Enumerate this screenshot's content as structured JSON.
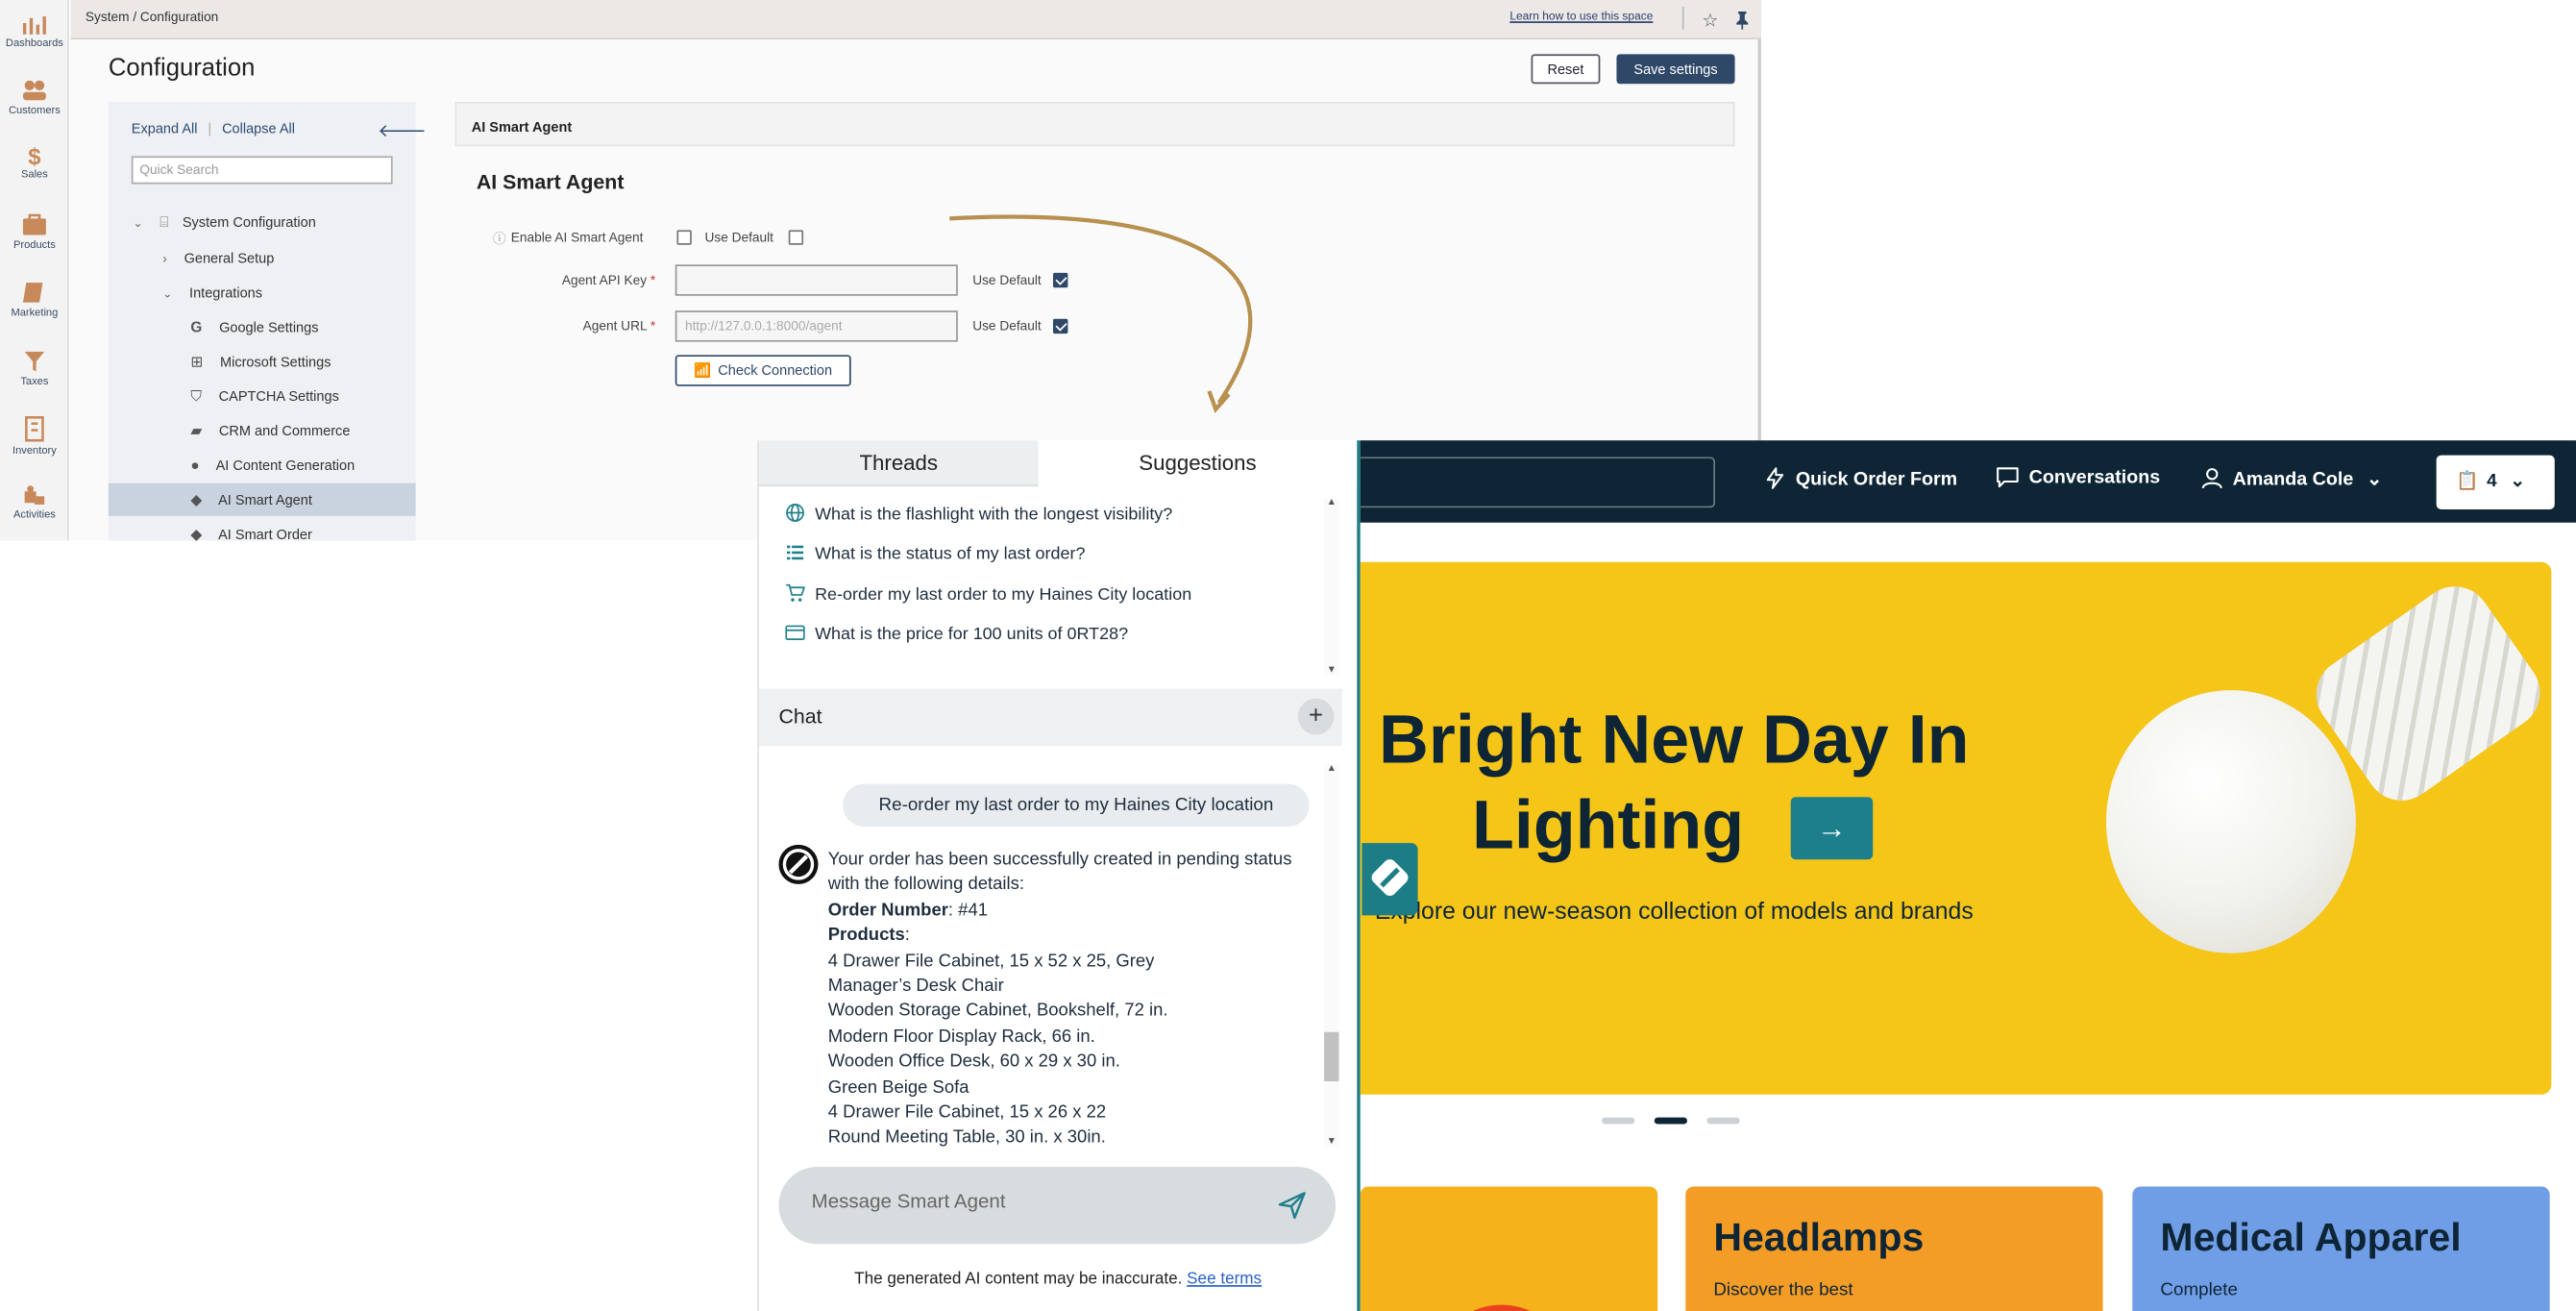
{
  "rail": {
    "items": [
      {
        "label": "Dashboards",
        "icon": "bar-chart-icon"
      },
      {
        "label": "Customers",
        "icon": "users-icon"
      },
      {
        "label": "Sales",
        "icon": "dollar-icon"
      },
      {
        "label": "Products",
        "icon": "box-icon"
      },
      {
        "label": "Marketing",
        "icon": "book-icon"
      },
      {
        "label": "Taxes",
        "icon": "funnel-icon"
      },
      {
        "label": "Inventory",
        "icon": "building-icon"
      },
      {
        "label": "Activities",
        "icon": "puzzle-icon"
      }
    ]
  },
  "admin": {
    "breadcrumb": "System / Configuration",
    "learn_link": "Learn how to use this space",
    "page_title": "Configuration",
    "reset_label": "Reset",
    "save_label": "Save settings",
    "tree": {
      "expand_all": "Expand All",
      "collapse_all": "Collapse All",
      "search_placeholder": "Quick Search",
      "nodes": [
        "System Configuration",
        "General Setup",
        "Integrations",
        "Google Settings",
        "Microsoft Settings",
        "CAPTCHA Settings",
        "CRM and Commerce",
        "AI Content Generation",
        "AI Smart Agent",
        "AI Smart Order"
      ]
    },
    "panel_breadcrumb": "AI Smart Agent",
    "section_title": "AI Smart Agent",
    "fields": {
      "enable_label": "Enable AI Smart Agent",
      "api_key_label": "Agent API Key",
      "url_label": "Agent URL",
      "url_placeholder": "http://127.0.0.1:8000/agent",
      "use_default": "Use Default",
      "enable_checked": false,
      "enable_use_default_checked": false,
      "api_use_default_checked": true,
      "url_use_default_checked": true
    },
    "check_connection": "Check Connection"
  },
  "chat": {
    "tabs": [
      "Threads",
      "Suggestions"
    ],
    "active_tab": "Suggestions",
    "suggestions": [
      {
        "icon": "globe-icon",
        "text": "What is the flashlight with the longest visibility?"
      },
      {
        "icon": "list-icon",
        "text": "What is the status of my last order?"
      },
      {
        "icon": "cart-icon",
        "text": "Re-order my last order to my Haines City location"
      },
      {
        "icon": "card-icon",
        "text": "What is the price for 100 units of 0RT28?"
      }
    ],
    "chat_title": "Chat",
    "user_message": "Re-order my last order to my Haines City location",
    "bot": {
      "intro": "Your order has been successfully created in pending status with the following details:",
      "order_label": "Order Number",
      "order_value": ": #41",
      "products_label": "Products",
      "products_colon": ":",
      "products": [
        "4 Drawer File Cabinet, 15 x 52 x 25, Grey",
        "Manager’s Desk Chair",
        "Wooden Storage Cabinet, Bookshelf, 72 in.",
        "Modern Floor Display Rack, 66 in.",
        "Wooden Office Desk, 60 x 29 x 30 in.",
        "Green Beige Sofa",
        "4 Drawer File Cabinet, 15 x 26 x 22",
        "Round Meeting Table, 30 in. x 30in."
      ]
    },
    "input_placeholder": "Message Smart Agent",
    "disclaimer": "The generated AI content may be inaccurate.",
    "terms_link": "See terms"
  },
  "store": {
    "nav": {
      "quick_order": "Quick Order Form",
      "conversations": "Conversations",
      "user": "Amanda Cole",
      "cart_count": "4"
    },
    "hero": {
      "title_line1": "Bright New Day In",
      "title_line2": "Lighting",
      "subtitle": "Explore our new-season collection of models and brands",
      "active_slide": 2,
      "slide_count": 3
    },
    "cards": [
      {
        "title": "",
        "desc": "",
        "color": "#f6b21b"
      },
      {
        "title": "Headlamps",
        "desc": "Discover the best",
        "color": "#f39c26"
      },
      {
        "title": "Medical Apparel",
        "desc": "Complete",
        "color": "#6f9de6"
      }
    ]
  },
  "colors": {
    "brand_dark": "#0e2535",
    "accent": "#1c7d86",
    "admin_primary": "#2f4868",
    "hero_bg": "#f5c518"
  }
}
